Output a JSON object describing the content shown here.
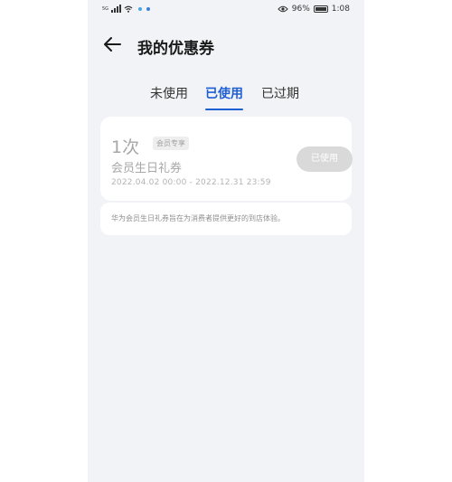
{
  "status_bar": {
    "left_indicator": "5G",
    "battery_percent": "96%",
    "time": "1:08"
  },
  "header": {
    "back_icon": "arrow-left-icon",
    "title": "我的优惠券"
  },
  "tabs": [
    {
      "label": "未使用",
      "active": false
    },
    {
      "label": "已使用",
      "active": true
    },
    {
      "label": "已过期",
      "active": false
    }
  ],
  "coupon": {
    "count": "1次",
    "badge": "会员专享",
    "name": "会员生日礼券",
    "validity": "2022.04.02 00:00 - 2022.12.31 23:59",
    "status_button": "已使用",
    "note": "华为会员生日礼券旨在为消费者提供更好的到店体验。"
  },
  "colors": {
    "accent": "#1f5fd4",
    "background": "#f2f3f6",
    "card": "#ffffff",
    "disabled_button": "#d9d9d9"
  }
}
